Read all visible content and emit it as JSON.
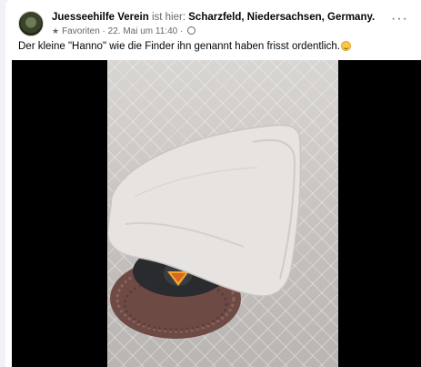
{
  "post": {
    "author": "Juesseehilfe Verein",
    "location_prefix": "ist hier:",
    "location": "Scharzfeld, Niedersachsen, Germany.",
    "audience_label": "Favoriten",
    "separator": "·",
    "timestamp": "22. Mai um 11:40",
    "separator2": "·",
    "caption": "Der kleine \"Hanno\" wie die Finder ihn genannt haben frisst ordentlich.",
    "more_label": "···"
  },
  "icons": {
    "avatar": "avatar",
    "star": "star-icon",
    "globe": "globe-icon",
    "more": "more-options-icon",
    "emoji": "smiling-face-emoji"
  },
  "colors": {
    "background": "#f0f2f5",
    "card": "#ffffff",
    "text": "#050505",
    "secondary_text": "#65676b",
    "video_background": "#000000"
  }
}
